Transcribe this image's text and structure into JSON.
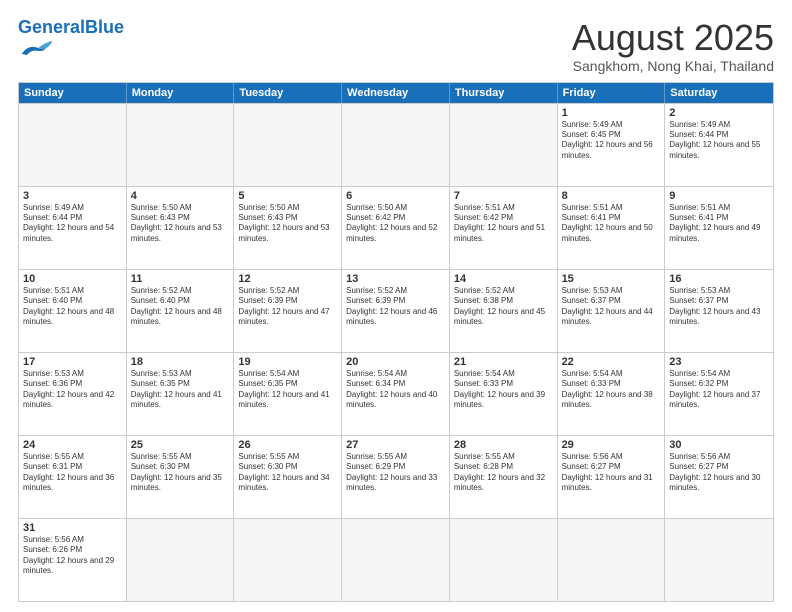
{
  "header": {
    "logo_general": "General",
    "logo_blue": "Blue",
    "month_year": "August 2025",
    "location": "Sangkhom, Nong Khai, Thailand"
  },
  "days_of_week": [
    "Sunday",
    "Monday",
    "Tuesday",
    "Wednesday",
    "Thursday",
    "Friday",
    "Saturday"
  ],
  "weeks": [
    [
      {
        "day": "",
        "empty": true
      },
      {
        "day": "",
        "empty": true
      },
      {
        "day": "",
        "empty": true
      },
      {
        "day": "",
        "empty": true
      },
      {
        "day": "",
        "empty": true
      },
      {
        "day": "1",
        "sunrise": "5:49 AM",
        "sunset": "6:45 PM",
        "daylight": "12 hours and 56 minutes."
      },
      {
        "day": "2",
        "sunrise": "5:49 AM",
        "sunset": "6:44 PM",
        "daylight": "12 hours and 55 minutes."
      }
    ],
    [
      {
        "day": "3",
        "sunrise": "5:49 AM",
        "sunset": "6:44 PM",
        "daylight": "12 hours and 54 minutes."
      },
      {
        "day": "4",
        "sunrise": "5:50 AM",
        "sunset": "6:43 PM",
        "daylight": "12 hours and 53 minutes."
      },
      {
        "day": "5",
        "sunrise": "5:50 AM",
        "sunset": "6:43 PM",
        "daylight": "12 hours and 53 minutes."
      },
      {
        "day": "6",
        "sunrise": "5:50 AM",
        "sunset": "6:42 PM",
        "daylight": "12 hours and 52 minutes."
      },
      {
        "day": "7",
        "sunrise": "5:51 AM",
        "sunset": "6:42 PM",
        "daylight": "12 hours and 51 minutes."
      },
      {
        "day": "8",
        "sunrise": "5:51 AM",
        "sunset": "6:41 PM",
        "daylight": "12 hours and 50 minutes."
      },
      {
        "day": "9",
        "sunrise": "5:51 AM",
        "sunset": "6:41 PM",
        "daylight": "12 hours and 49 minutes."
      }
    ],
    [
      {
        "day": "10",
        "sunrise": "5:51 AM",
        "sunset": "6:40 PM",
        "daylight": "12 hours and 48 minutes."
      },
      {
        "day": "11",
        "sunrise": "5:52 AM",
        "sunset": "6:40 PM",
        "daylight": "12 hours and 48 minutes."
      },
      {
        "day": "12",
        "sunrise": "5:52 AM",
        "sunset": "6:39 PM",
        "daylight": "12 hours and 47 minutes."
      },
      {
        "day": "13",
        "sunrise": "5:52 AM",
        "sunset": "6:39 PM",
        "daylight": "12 hours and 46 minutes."
      },
      {
        "day": "14",
        "sunrise": "5:52 AM",
        "sunset": "6:38 PM",
        "daylight": "12 hours and 45 minutes."
      },
      {
        "day": "15",
        "sunrise": "5:53 AM",
        "sunset": "6:37 PM",
        "daylight": "12 hours and 44 minutes."
      },
      {
        "day": "16",
        "sunrise": "5:53 AM",
        "sunset": "6:37 PM",
        "daylight": "12 hours and 43 minutes."
      }
    ],
    [
      {
        "day": "17",
        "sunrise": "5:53 AM",
        "sunset": "6:36 PM",
        "daylight": "12 hours and 42 minutes."
      },
      {
        "day": "18",
        "sunrise": "5:53 AM",
        "sunset": "6:35 PM",
        "daylight": "12 hours and 41 minutes."
      },
      {
        "day": "19",
        "sunrise": "5:54 AM",
        "sunset": "6:35 PM",
        "daylight": "12 hours and 41 minutes."
      },
      {
        "day": "20",
        "sunrise": "5:54 AM",
        "sunset": "6:34 PM",
        "daylight": "12 hours and 40 minutes."
      },
      {
        "day": "21",
        "sunrise": "5:54 AM",
        "sunset": "6:33 PM",
        "daylight": "12 hours and 39 minutes."
      },
      {
        "day": "22",
        "sunrise": "5:54 AM",
        "sunset": "6:33 PM",
        "daylight": "12 hours and 38 minutes."
      },
      {
        "day": "23",
        "sunrise": "5:54 AM",
        "sunset": "6:32 PM",
        "daylight": "12 hours and 37 minutes."
      }
    ],
    [
      {
        "day": "24",
        "sunrise": "5:55 AM",
        "sunset": "6:31 PM",
        "daylight": "12 hours and 36 minutes."
      },
      {
        "day": "25",
        "sunrise": "5:55 AM",
        "sunset": "6:30 PM",
        "daylight": "12 hours and 35 minutes."
      },
      {
        "day": "26",
        "sunrise": "5:55 AM",
        "sunset": "6:30 PM",
        "daylight": "12 hours and 34 minutes."
      },
      {
        "day": "27",
        "sunrise": "5:55 AM",
        "sunset": "6:29 PM",
        "daylight": "12 hours and 33 minutes."
      },
      {
        "day": "28",
        "sunrise": "5:55 AM",
        "sunset": "6:28 PM",
        "daylight": "12 hours and 32 minutes."
      },
      {
        "day": "29",
        "sunrise": "5:56 AM",
        "sunset": "6:27 PM",
        "daylight": "12 hours and 31 minutes."
      },
      {
        "day": "30",
        "sunrise": "5:56 AM",
        "sunset": "6:27 PM",
        "daylight": "12 hours and 30 minutes."
      }
    ],
    [
      {
        "day": "31",
        "sunrise": "5:56 AM",
        "sunset": "6:26 PM",
        "daylight": "12 hours and 29 minutes.",
        "has_data": true
      },
      {
        "day": "",
        "empty": true
      },
      {
        "day": "",
        "empty": true
      },
      {
        "day": "",
        "empty": true
      },
      {
        "day": "",
        "empty": true
      },
      {
        "day": "",
        "empty": true
      },
      {
        "day": "",
        "empty": true
      }
    ]
  ]
}
